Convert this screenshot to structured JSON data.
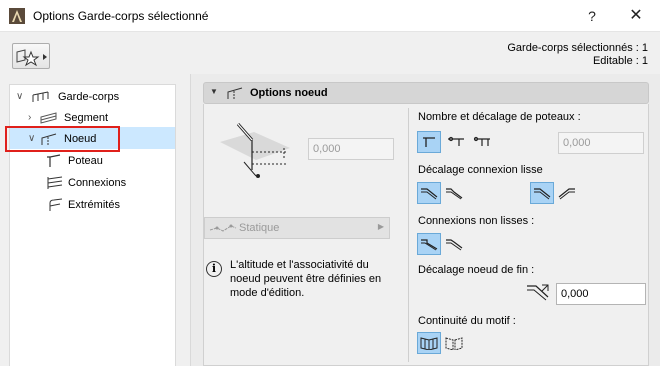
{
  "window": {
    "title": "Options Garde-corps sélectionné",
    "help": "?",
    "close": "✕"
  },
  "selection": {
    "line1": "Garde-corps sélectionnés : 1",
    "line2": "Editable : 1"
  },
  "tree": {
    "root": "Garde-corps",
    "segment": "Segment",
    "noeud": "Noeud",
    "poteau": "Poteau",
    "connexions": "Connexions",
    "extremites": "Extrémités"
  },
  "section": {
    "title": "Options noeud"
  },
  "left": {
    "height_value": "0,000",
    "static_label": "Statique",
    "info": "L'altitude et l'associativité du noeud peuvent être définies en mode d'édition."
  },
  "right": {
    "posts_label": "Nombre et décalage de poteaux :",
    "posts_value": "0,000",
    "smooth_label": "Décalage connexion lisse",
    "nonsmooth_label": "Connexions non lisses :",
    "end_offset_label": "Décalage noeud de fin :",
    "end_offset_value": "0,000",
    "continuity_label": "Continuité du motif :"
  },
  "colors": {
    "selection_bg": "#cce8ff",
    "highlight_box": "#e0201b",
    "active_button": "#a9d3f5"
  }
}
